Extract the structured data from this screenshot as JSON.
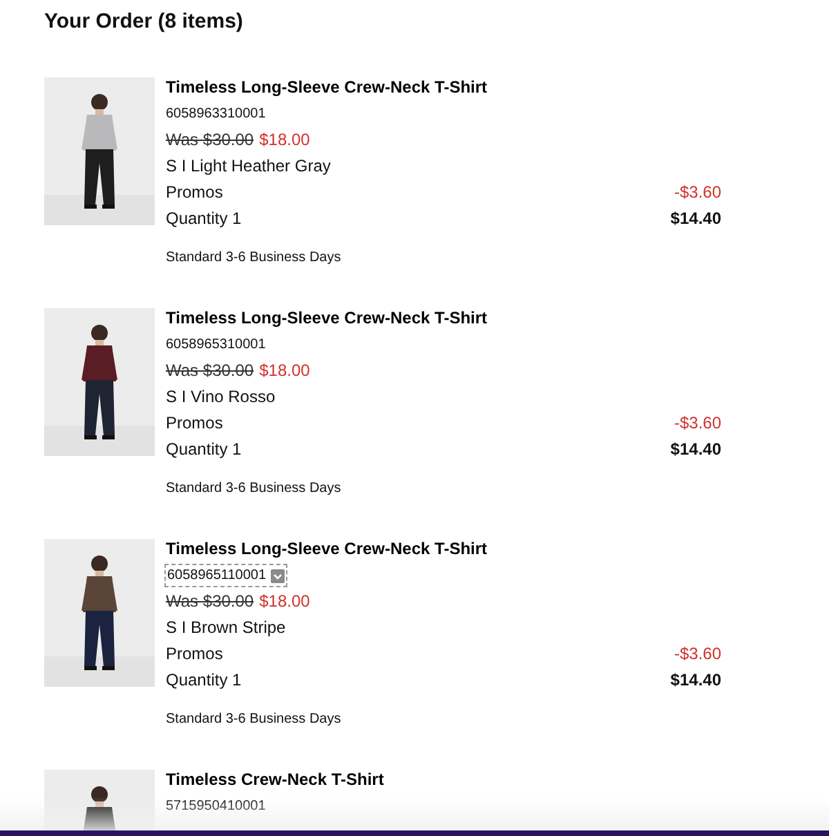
{
  "title": "Your Order (8 items)",
  "items": [
    {
      "name": "Timeless Long-Sleeve Crew-Neck T-Shirt",
      "sku": "6058963310001",
      "sku_focused": false,
      "was_price": "Was $30.00",
      "price": "$18.00",
      "variant": "S I Light Heather Gray",
      "promos_label": "Promos",
      "promos_value": "-$3.60",
      "quantity": "Quantity 1",
      "total": "$14.40",
      "shipping": "Standard 3-6 Business Days"
    },
    {
      "name": "Timeless Long-Sleeve Crew-Neck T-Shirt",
      "sku": "6058965310001",
      "sku_focused": false,
      "was_price": "Was $30.00",
      "price": "$18.00",
      "variant": "S I Vino Rosso",
      "promos_label": "Promos",
      "promos_value": "-$3.60",
      "quantity": "Quantity 1",
      "total": "$14.40",
      "shipping": "Standard 3-6 Business Days"
    },
    {
      "name": "Timeless Long-Sleeve Crew-Neck T-Shirt",
      "sku": "6058965110001",
      "sku_focused": true,
      "was_price": "Was $30.00",
      "price": "$18.00",
      "variant": "S I Brown Stripe",
      "promos_label": "Promos",
      "promos_value": "-$3.60",
      "quantity": "Quantity 1",
      "total": "$14.40",
      "shipping": "Standard 3-6 Business Days"
    },
    {
      "name": "Timeless Crew-Neck T-Shirt",
      "sku": "5715950410001",
      "sku_focused": false
    }
  ]
}
